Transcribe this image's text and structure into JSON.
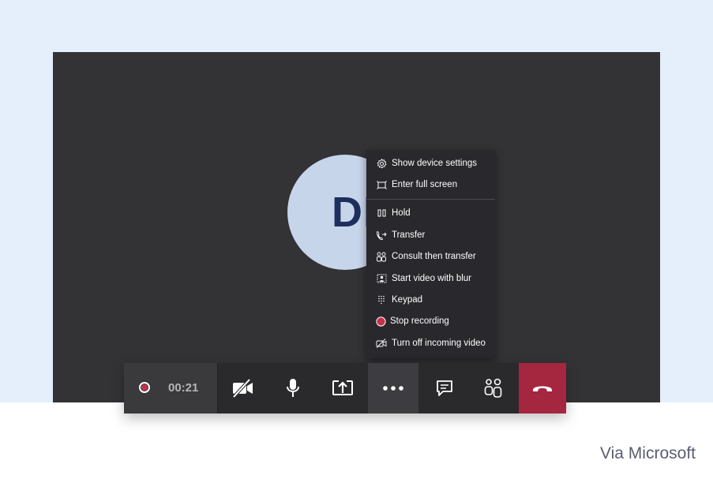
{
  "call": {
    "avatar_initials": "DB",
    "timer": "00:21"
  },
  "more_menu": {
    "items": [
      {
        "label": "Show device settings",
        "icon": "gear-icon"
      },
      {
        "label": "Enter full screen",
        "icon": "fullscreen-icon"
      },
      {
        "label": "Hold",
        "icon": "pause-icon"
      },
      {
        "label": "Transfer",
        "icon": "phone-forward-icon"
      },
      {
        "label": "Consult then transfer",
        "icon": "people-icon"
      },
      {
        "label": "Start video with blur",
        "icon": "blur-icon"
      },
      {
        "label": "Keypad",
        "icon": "dialpad-icon"
      },
      {
        "label": "Stop recording",
        "icon": "record-icon"
      },
      {
        "label": "Turn off incoming video",
        "icon": "video-off-icon"
      }
    ]
  },
  "toolbar": {
    "buttons": [
      "video-off-icon",
      "microphone-icon",
      "share-screen-icon",
      "more-icon",
      "chat-icon",
      "participants-icon",
      "hang-up-icon"
    ]
  },
  "colors": {
    "stage": "#333235",
    "menu": "#29282c",
    "recording": "#c4314b",
    "hangup": "#a4263f",
    "avatar": "#c7d5eb"
  },
  "credit": "Via Microsoft"
}
